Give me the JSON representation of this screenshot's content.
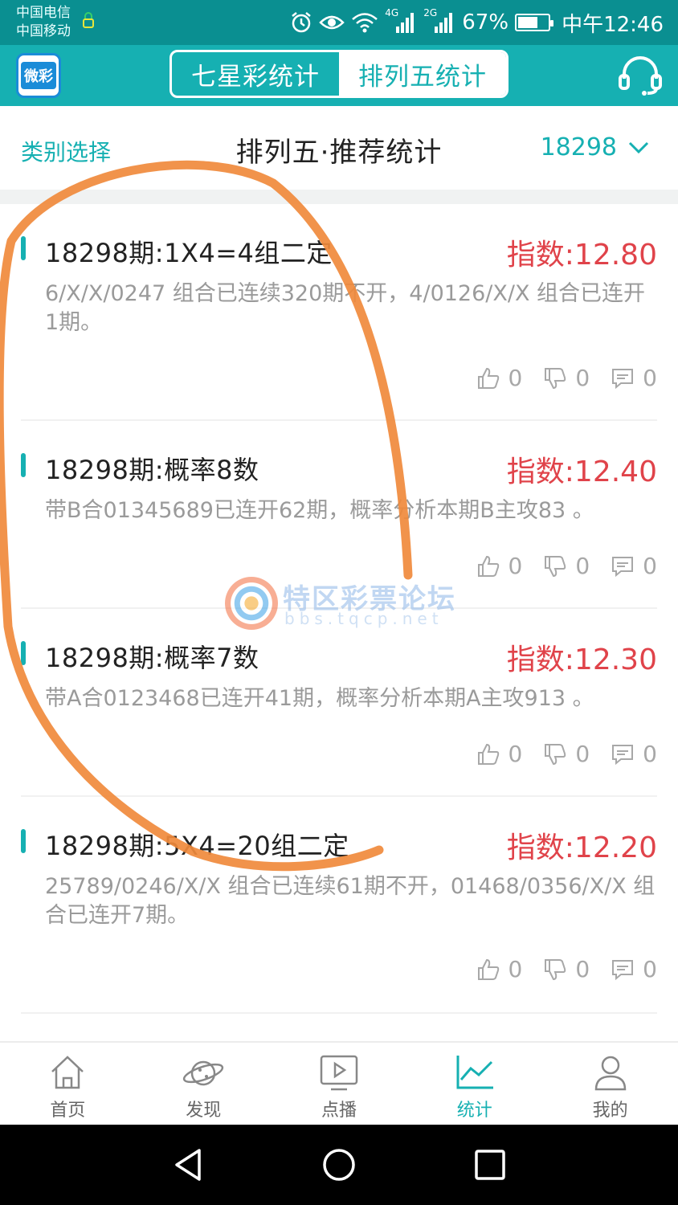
{
  "status_bar": {
    "carrier_1": "中国电信",
    "carrier_2": "中国移动",
    "network_1": "4G",
    "network_2": "2G",
    "battery_percent": "67%",
    "battery_level": 0.67,
    "time": "中午12:46",
    "icons": [
      "alarm-icon",
      "eye-icon",
      "wifi-icon",
      "signal-icon",
      "signal-icon",
      "battery-icon"
    ]
  },
  "header": {
    "logo_text": "微彩",
    "tabs": [
      {
        "label": "七星彩统计",
        "active": false
      },
      {
        "label": "排列五统计",
        "active": true
      }
    ],
    "support_icon": "headset-icon"
  },
  "subheader": {
    "category_select": "类别选择",
    "title": "排列五·推荐统计",
    "issue": "18298"
  },
  "cards": [
    {
      "title": "18298期:1X4=4组二定",
      "index": "指数:12.80",
      "desc": "6/X/X/0247 组合已连续320期不开，4/0126/X/X 组合已连开1期。",
      "likes": "0",
      "dislikes": "0",
      "comments": "0"
    },
    {
      "title": "18298期:概率8数",
      "index": "指数:12.40",
      "desc": "带B合01345689已连开62期，概率分析本期B主攻83 。",
      "likes": "0",
      "dislikes": "0",
      "comments": "0"
    },
    {
      "title": "18298期:概率7数",
      "index": "指数:12.30",
      "desc": "带A合0123468已连开41期，概率分析本期A主攻913 。",
      "likes": "0",
      "dislikes": "0",
      "comments": "0"
    },
    {
      "title": "18298期:5X4=20组二定",
      "index": "指数:12.20",
      "desc": "25789/0246/X/X 组合已连续61期不开，01468/0356/X/X 组合已连开7期。",
      "likes": "0",
      "dislikes": "0",
      "comments": "0"
    }
  ],
  "watermark": {
    "text": "特区彩票论坛",
    "url": "bbs.tqcp.net"
  },
  "bottom_nav": [
    {
      "label": "首页",
      "icon": "home-icon",
      "active": false
    },
    {
      "label": "发现",
      "icon": "planet-icon",
      "active": false
    },
    {
      "label": "点播",
      "icon": "play-icon",
      "active": false
    },
    {
      "label": "统计",
      "icon": "chart-icon",
      "active": true
    },
    {
      "label": "我的",
      "icon": "user-icon",
      "active": false
    }
  ],
  "colors": {
    "status_bar": "#0a8f91",
    "accent": "#16b0b2",
    "index_red": "#e0434a",
    "annotation": "#f08a3c"
  }
}
